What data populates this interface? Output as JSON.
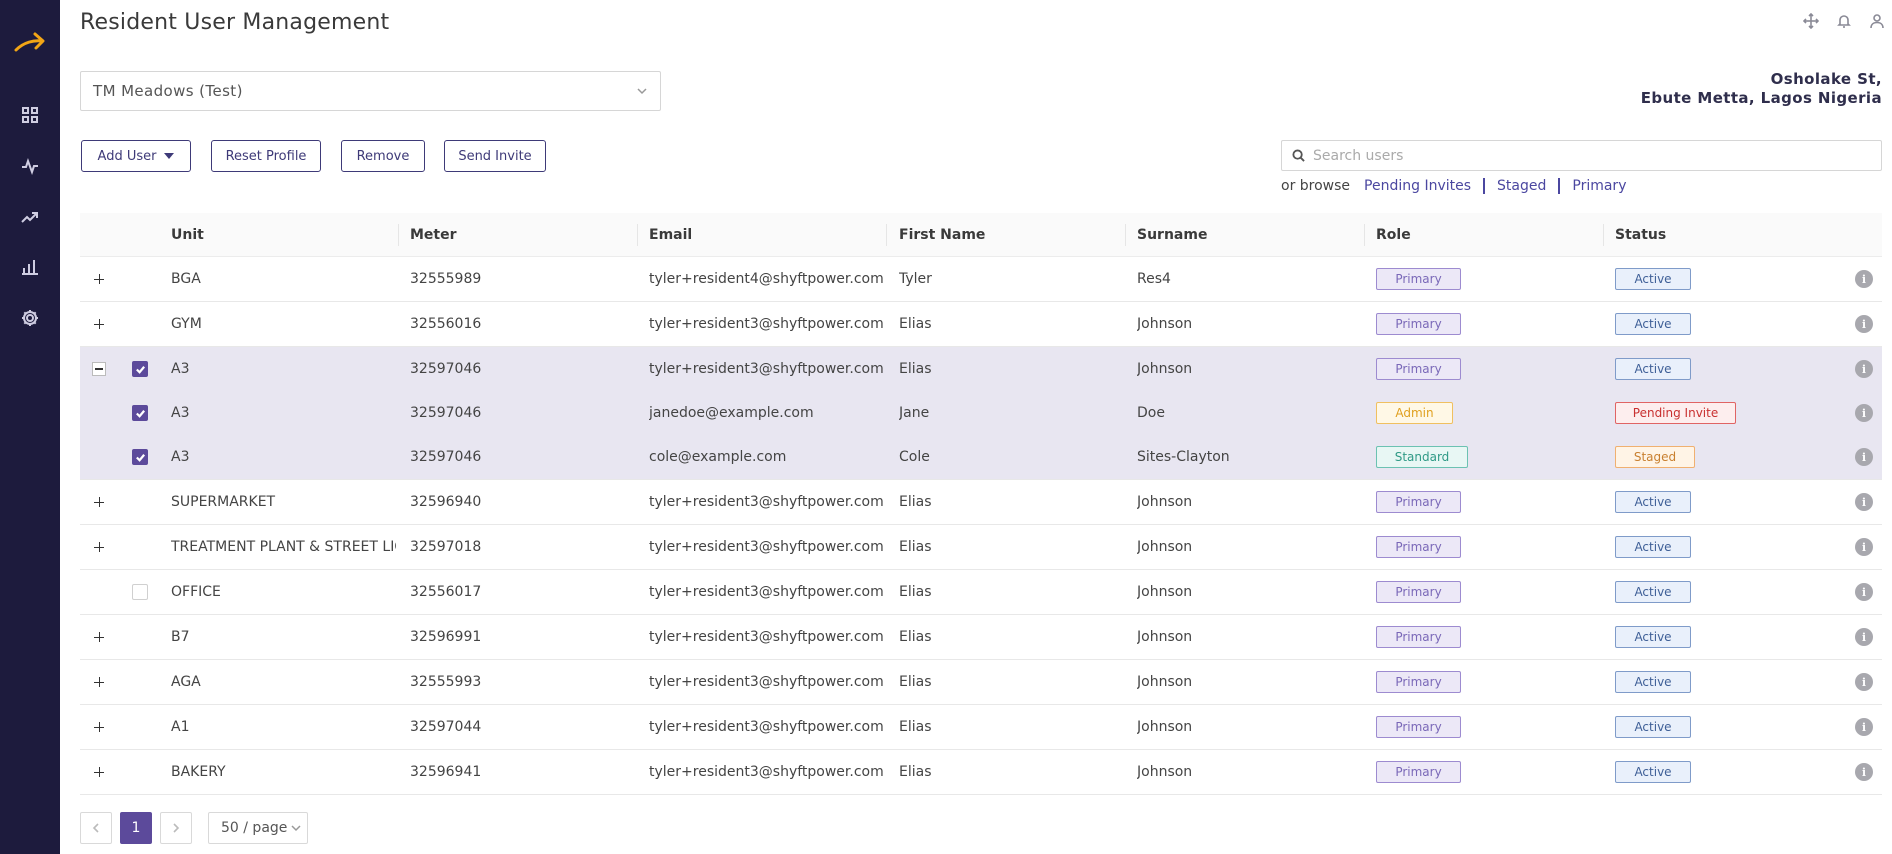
{
  "header": {
    "title": "Resident User Management"
  },
  "site": {
    "selected": "TM Meadows (Test)"
  },
  "address": {
    "line1": "Osholake St,",
    "line2": "Ebute Metta, Lagos Nigeria"
  },
  "toolbar": {
    "add_user": "Add User",
    "reset_profile": "Reset Profile",
    "remove": "Remove",
    "send_invite": "Send Invite"
  },
  "search": {
    "placeholder": "Search users"
  },
  "browse": {
    "prefix": "or browse",
    "links": [
      "Pending Invites",
      "Staged",
      "Primary"
    ]
  },
  "table": {
    "columns": [
      "Unit",
      "Meter",
      "Email",
      "First Name",
      "Surname",
      "Role",
      "Status"
    ],
    "rows": [
      {
        "unit": "BGA",
        "meter": "32555989",
        "email": "tyler+resident4@shyftpower.com",
        "first": "Tyler",
        "surname": "Res4",
        "role": "Primary",
        "status": "Active"
      },
      {
        "unit": "GYM",
        "meter": "32556016",
        "email": "tyler+resident3@shyftpower.com",
        "first": "Elias",
        "surname": "Johnson",
        "role": "Primary",
        "status": "Active"
      },
      {
        "unit": "A3",
        "meter": "32597046",
        "email": "tyler+resident3@shyftpower.com",
        "first": "Elias",
        "surname": "Johnson",
        "role": "Primary",
        "status": "Active"
      },
      {
        "unit": "A3",
        "meter": "32597046",
        "email": "janedoe@example.com",
        "first": "Jane",
        "surname": "Doe",
        "role": "Admin",
        "status": "Pending Invite"
      },
      {
        "unit": "A3",
        "meter": "32597046",
        "email": "cole@example.com",
        "first": "Cole",
        "surname": "Sites-Clayton",
        "role": "Standard",
        "status": "Staged"
      },
      {
        "unit": "SUPERMARKET",
        "meter": "32596940",
        "email": "tyler+resident3@shyftpower.com",
        "first": "Elias",
        "surname": "Johnson",
        "role": "Primary",
        "status": "Active"
      },
      {
        "unit": "TREATMENT PLANT & STREET LIG...",
        "meter": "32597018",
        "email": "tyler+resident3@shyftpower.com",
        "first": "Elias",
        "surname": "Johnson",
        "role": "Primary",
        "status": "Active"
      },
      {
        "unit": "OFFICE",
        "meter": "32556017",
        "email": "tyler+resident3@shyftpower.com",
        "first": "Elias",
        "surname": "Johnson",
        "role": "Primary",
        "status": "Active"
      },
      {
        "unit": "B7",
        "meter": "32596991",
        "email": "tyler+resident3@shyftpower.com",
        "first": "Elias",
        "surname": "Johnson",
        "role": "Primary",
        "status": "Active"
      },
      {
        "unit": "AGA",
        "meter": "32555993",
        "email": "tyler+resident3@shyftpower.com",
        "first": "Elias",
        "surname": "Johnson",
        "role": "Primary",
        "status": "Active"
      },
      {
        "unit": "A1",
        "meter": "32597044",
        "email": "tyler+resident3@shyftpower.com",
        "first": "Elias",
        "surname": "Johnson",
        "role": "Primary",
        "status": "Active"
      },
      {
        "unit": "BAKERY",
        "meter": "32596941",
        "email": "tyler+resident3@shyftpower.com",
        "first": "Elias",
        "surname": "Johnson",
        "role": "Primary",
        "status": "Active"
      }
    ]
  },
  "pagination": {
    "current": "1",
    "page_size": "50 / page"
  },
  "colors": {
    "sidebar": "#1d1b3d",
    "accent": "#5c4a9b",
    "logo": "#f2a516"
  },
  "icons": {
    "sidebar": [
      "grid-icon",
      "pulse-icon",
      "trend-icon",
      "bar-chart-icon",
      "gear-icon"
    ],
    "top": [
      "move-icon",
      "bell-icon",
      "user-icon"
    ]
  }
}
